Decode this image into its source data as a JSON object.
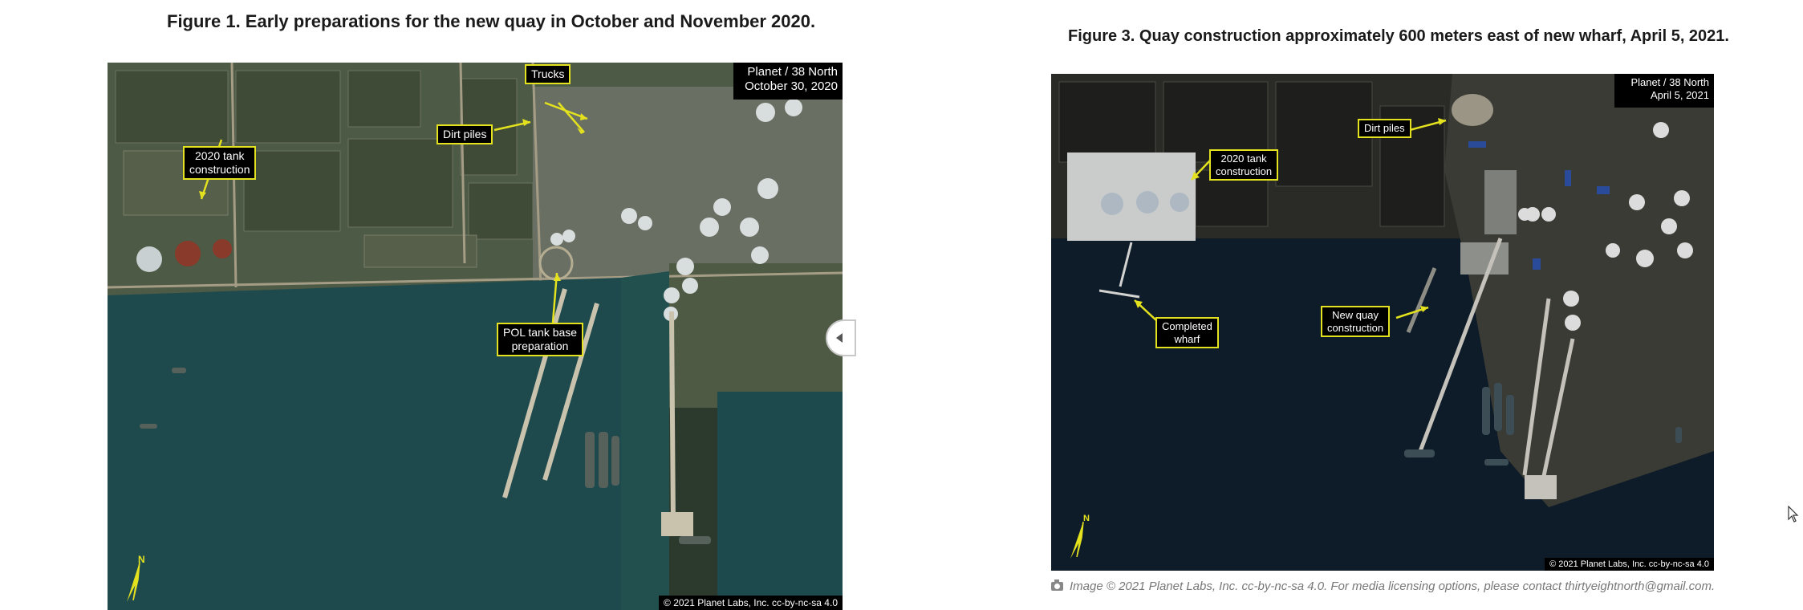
{
  "figure1": {
    "title": "Figure 1. Early preparations for the new quay in October and November 2020.",
    "stamp_line1": "Planet / 38 North",
    "stamp_line2": "October 30, 2020",
    "copyright": "© 2021 Planet Labs, Inc. cc-by-nc-sa 4.0",
    "north": "N",
    "labels": {
      "trucks": "Trucks",
      "dirt_piles": "Dirt piles",
      "tank_line1": "2020 tank",
      "tank_line2": "construction",
      "pol_line1": "POL tank base",
      "pol_line2": "preparation"
    }
  },
  "figure3": {
    "title": "Figure 3. Quay construction approximately 600 meters east of new wharf, April 5, 2021.",
    "stamp_line1": "Planet / 38 North",
    "stamp_line2": "April 5, 2021",
    "copyright": "© 2021 Planet Labs, Inc. cc-by-nc-sa 4.0",
    "north": "N",
    "labels": {
      "dirt_piles": "Dirt piles",
      "tank_line1": "2020 tank",
      "tank_line2": "construction",
      "wharf_line1": "Completed",
      "wharf_line2": "wharf",
      "quay_line1": "New quay",
      "quay_line2": "construction"
    }
  },
  "caption": "Image © 2021 Planet Labs, Inc. cc-by-nc-sa 4.0. For media licensing options, please contact thirtyeightnorth@gmail.com.",
  "colors": {
    "label_border": "#e4e21e",
    "water_fig1": "#1e4a4e",
    "water_fig3": "#0d1c28"
  }
}
